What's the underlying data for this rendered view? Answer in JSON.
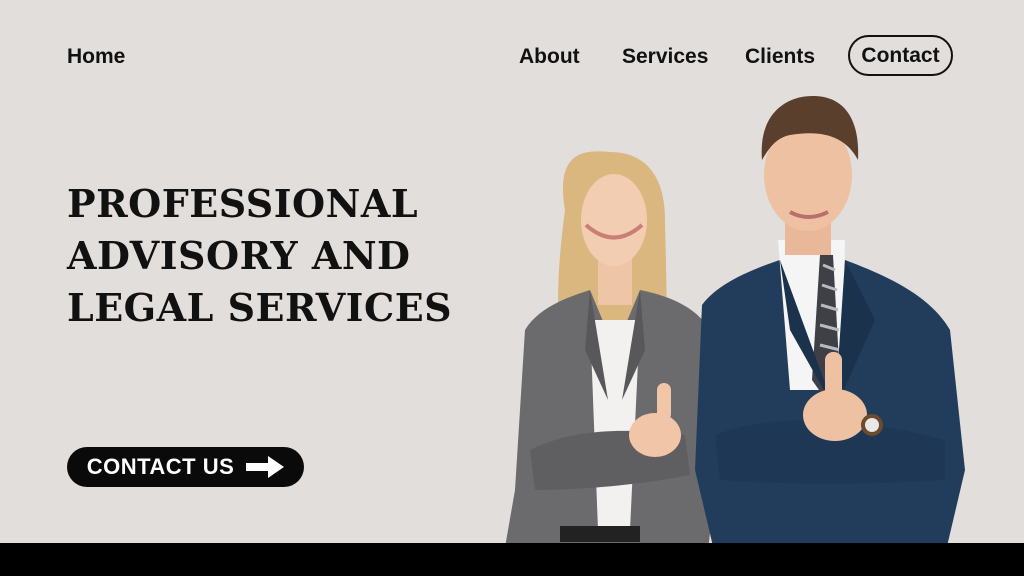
{
  "nav": {
    "home": "Home",
    "about": "About",
    "services": "Services",
    "clients": "Clients",
    "contact": "Contact"
  },
  "hero": {
    "title_lines": [
      "PROFESSIONAL",
      "ADVISORY AND",
      "LEGAL SERVICES"
    ],
    "cta_label": "CONTACT US",
    "cta_icon": "arrow-right-icon"
  },
  "colors": {
    "background": "#e2dedc",
    "text": "#111111",
    "cta_background": "#0a0a0a",
    "footer_bar": "#000000"
  },
  "photo": {
    "subject": "business-professionals-thumbs-up"
  }
}
